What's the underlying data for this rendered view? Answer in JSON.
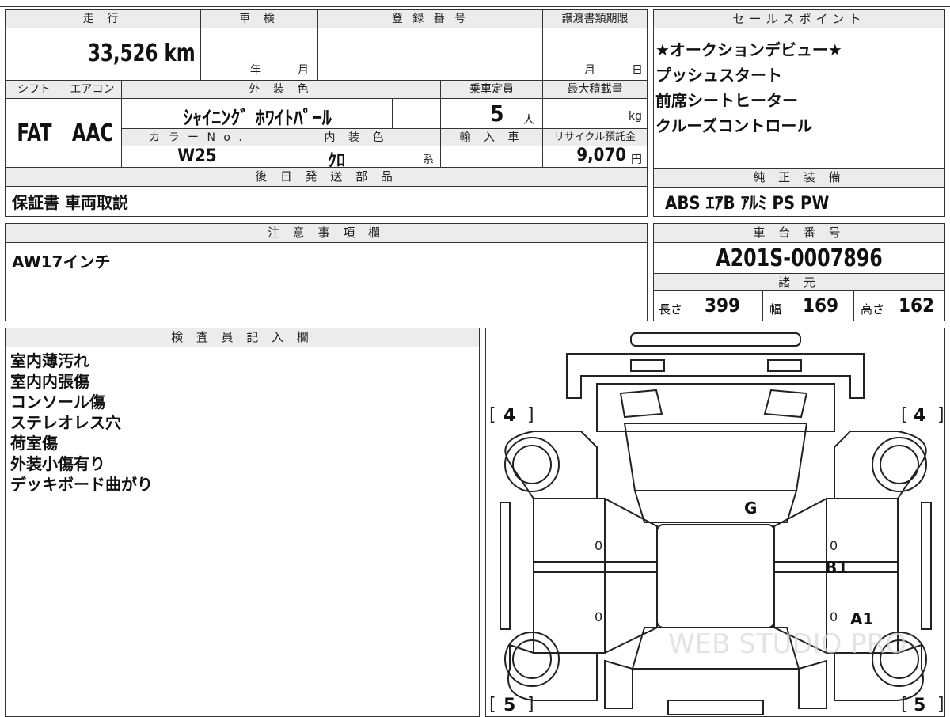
{
  "vehicle_info": {
    "mileage_label": "走 行",
    "mileage_value": "33,526 km",
    "inspection_label": "車 検",
    "inspection_year_unit": "年",
    "inspection_month_unit": "月",
    "registration_label": "登 録 番 号",
    "transfer_docs_label": "譲渡書類期限",
    "transfer_month_unit": "月",
    "transfer_day_unit": "日",
    "shift_label": "シフト",
    "shift_value": "FAT",
    "ac_label": "エアコン",
    "ac_value": "AAC",
    "exterior_color_label": "外 装 色",
    "exterior_color_value": "ｼｬｲﾆﾝｸﾞ ﾎﾜｲﾄﾊﾟｰﾙ",
    "capacity_label": "乗車定員",
    "capacity_value": "5",
    "capacity_unit": "人",
    "max_load_label": "最大積載量",
    "max_load_unit": "kg",
    "color_no_label": "カ ラ ー N o .",
    "color_no_value": "W25",
    "interior_color_label": "内 装 色",
    "interior_color_value": "ｸﾛ",
    "interior_color_suffix": "系",
    "import_label": "輸 入 車",
    "recycle_label": "リサイクル預託金",
    "recycle_value": "9,070",
    "recycle_unit": "円"
  },
  "later_parts": {
    "label": "後 日 発 送 部 品",
    "value": "保証書 車両取説"
  },
  "sales_points": {
    "label": "セールスポイント",
    "items": [
      "★オークションデビュー★",
      "プッシュスタート",
      "前席シートヒーター",
      "クルーズコントロール"
    ]
  },
  "standard_equipment": {
    "label": "純 正 装 備",
    "value": "ABS ｴｱB ｱﾙﾐ PS PW"
  },
  "notes": {
    "label": "注 意 事 項 欄",
    "value": "AW17インチ"
  },
  "chassis": {
    "label": "車 台 番 号",
    "value": "A201S-0007896"
  },
  "specs": {
    "label": "諸 元",
    "length_label": "長さ",
    "length_value": "399",
    "width_label": "幅",
    "width_value": "169",
    "height_label": "高さ",
    "height_value": "162"
  },
  "inspector": {
    "label": "検 査 員 記 入 欄",
    "lines": [
      "室内薄汚れ",
      "室内内張傷",
      "コンソール傷",
      "ステレオレス穴",
      "荷室傷",
      "外装小傷有り",
      "デッキボード曲がり"
    ]
  },
  "diagram": {
    "tire_front_left": "4",
    "tire_front_right": "4",
    "tire_rear_left": "5",
    "tire_rear_right": "5",
    "mark_glass": "G",
    "mark_b1": "B1",
    "mark_a1": "A1",
    "zero": "0",
    "watermark": "WEB STUDIO PRO"
  }
}
